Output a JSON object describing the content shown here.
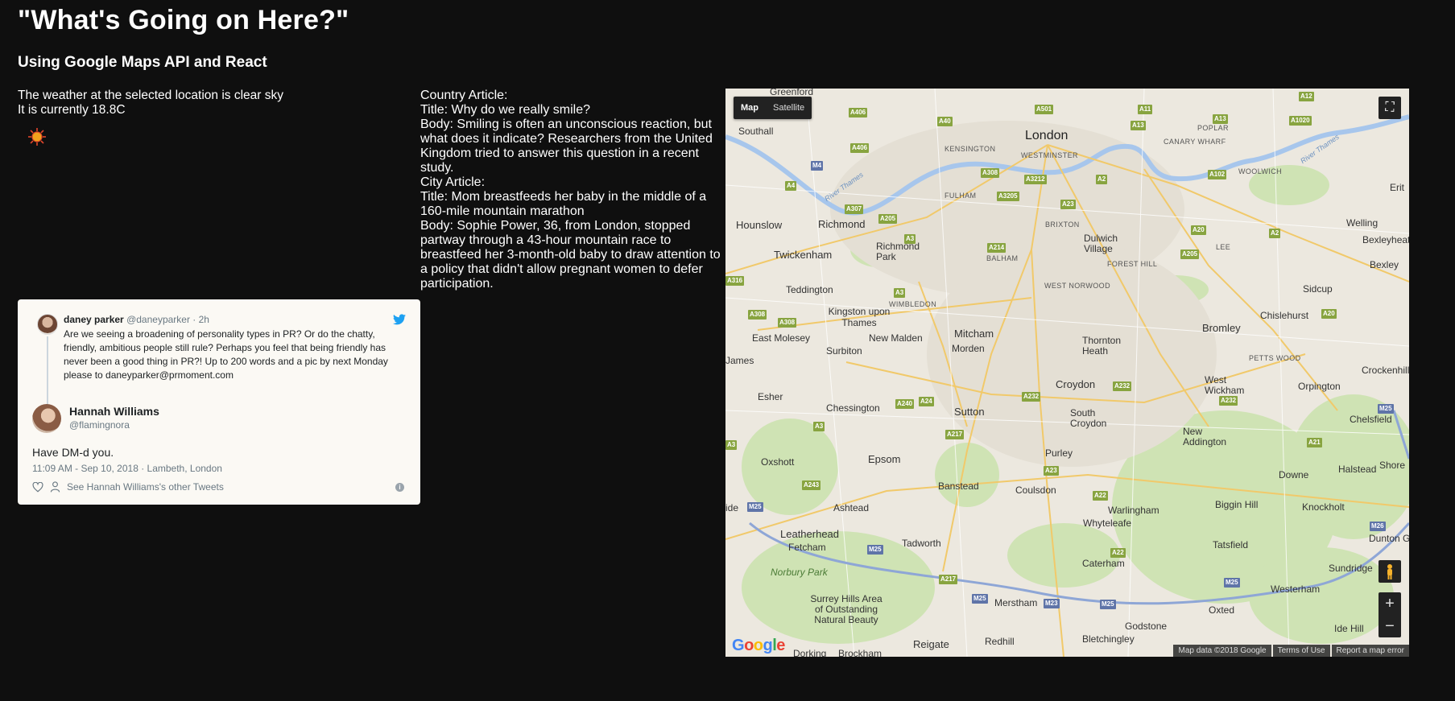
{
  "page": {
    "title": "\"What's Going on Here?\"",
    "subtitle": "Using Google Maps API and React"
  },
  "weather": {
    "line1": "The weather at the selected location is clear sky",
    "line2": "It is currently 18.8C",
    "icon": "sun-icon"
  },
  "articles": {
    "country_header": "Country Article:",
    "country_title": "Title: Why do we really smile?",
    "country_body": "Body: Smiling is often an unconscious reaction, but what does it indicate? Researchers from the United Kingdom tried to answer this question in a recent study.",
    "city_header": "City Article:",
    "city_title": "Title: Mom breastfeeds her baby in the middle of a 160-mile mountain marathon",
    "city_body": "Body: Sophie Power, 36, from London, stopped partway through a 43-hour mountain race to breastfeed her 3-month-old baby to draw attention to a policy that didn't allow pregnant women to defer participation."
  },
  "tweet": {
    "quoted": {
      "name": "daney parker",
      "handle": "@daneyparker",
      "time": "· 2h",
      "text": "Are we seeing a broadening of personality types in PR? Or do the chatty, friendly, ambitious people still rule? Perhaps you feel that being  friendly has never been a good thing in PR?! Up to 200 words and a pic by  next Monday please to daneyparker@prmoment.com"
    },
    "author_name": "Hannah Williams",
    "author_handle": "@flamingnora",
    "text": "Have DM-d you.",
    "meta": "11:09 AM - Sep 10, 2018 · Lambeth, London",
    "other_tweets": "See Hannah Williams's other Tweets",
    "colors": {
      "bird": "#1da1f2"
    }
  },
  "map": {
    "type_buttons": [
      "Map",
      "Satellite"
    ],
    "active_type": "Map",
    "zoom_in": "+",
    "zoom_out": "−",
    "logo": "Google",
    "attribution": [
      "Map data ©2018 Google",
      "Terms of Use",
      "Report a map error"
    ],
    "places": {
      "london": "London",
      "greenford": "Greenford",
      "southall": "Southall",
      "kensington": "KENSINGTON",
      "westminster": "WESTMINSTER",
      "poplar": "POPLAR",
      "canary": "CANARY WHARF",
      "woolwich": "WOOLWICH",
      "fulham": "FULHAM",
      "brixton": "BRIXTON",
      "hounslow": "Hounslow",
      "richmond": "Richmond",
      "welling": "Welling",
      "bexleyheath": "Bexleyheath",
      "lee": "LEE",
      "twickenham": "Twickenham",
      "richmond_park": "Richmond Park",
      "balham": "BALHAM",
      "dulwich": "Dulwich Village",
      "forest_hill": "FOREST HILL",
      "bexley": "Bexley",
      "teddington": "Teddington",
      "wimbledon": "WIMBLEDON",
      "west_norwood": "WEST NORWOOD",
      "sidcup": "Sidcup",
      "kingston": "Kingston upon Thames",
      "chislehurst": "Chislehurst",
      "east_molesey": "East Molesey",
      "new_malden": "New Malden",
      "mitcham": "Mitcham",
      "bromley": "Bromley",
      "surbiton": "Surbiton",
      "morden": "Morden",
      "thornton": "Thornton Heath",
      "petts_wood": "PETTS WOOD",
      "crockenhill": "Crockenhill",
      "croydon": "Croydon",
      "west_wickham": "West Wickham",
      "orpington": "Orpington",
      "esher": "Esher",
      "chessington": "Chessington",
      "sutton": "Sutton",
      "south_croydon": "South Croydon",
      "chelsfield": "Chelsfield",
      "new_addington": "New Addington",
      "oxshott": "Oxshott",
      "epsom": "Epsom",
      "purley": "Purley",
      "halstead": "Halstead",
      "banstead": "Banstead",
      "coulsdon": "Coulsdon",
      "downe": "Downe",
      "ashtead": "Ashtead",
      "warlingham": "Warlingham",
      "biggin_hill": "Biggin Hill",
      "knockholt": "Knockholt",
      "whyteleafe": "Whyteleafe",
      "leatherhead": "Leatherhead",
      "tadworth": "Tadworth",
      "fetcham": "Fetcham",
      "tatsfield": "Tatsfield",
      "dunton": "Dunton Gr",
      "caterham": "Caterham",
      "sundridge": "Sundridge",
      "norbury_park": "Norbury Park",
      "westerham": "Westerham",
      "surrey_hills": "Surrey Hills Area of Outstanding Natural Beauty",
      "merstham": "Merstham",
      "oxted": "Oxted",
      "godstone": "Godstone",
      "ide_hill": "Ide Hill",
      "reigate": "Reigate",
      "redhill": "Redhill",
      "bletchingley": "Bletchingley",
      "dorking": "Dorking",
      "brockham": "Brockham",
      "shore": "Shore",
      "erit": "Erit",
      "james": "James",
      "ide": "ide",
      "river_thames": "River Thames"
    },
    "roads": {
      "a40": "A40",
      "a406": "A406",
      "a501": "A501",
      "a11": "A11",
      "a12": "A12",
      "a13": "A13",
      "a1020": "A1020",
      "m4": "M4",
      "a4": "A4",
      "a308": "A308",
      "a3212": "A3212",
      "a2": "A2",
      "a102": "A102",
      "a3205": "A3205",
      "a23": "A23",
      "a307": "A307",
      "a205": "A205",
      "a20": "A20",
      "a3": "A3",
      "a214": "A214",
      "a316": "A316",
      "a240": "A240",
      "a24": "A24",
      "a232": "A232",
      "a217": "A217",
      "a21": "A21",
      "a243": "A243",
      "a22": "A22",
      "m25": "M25",
      "m23": "M23",
      "m26": "M26"
    }
  }
}
